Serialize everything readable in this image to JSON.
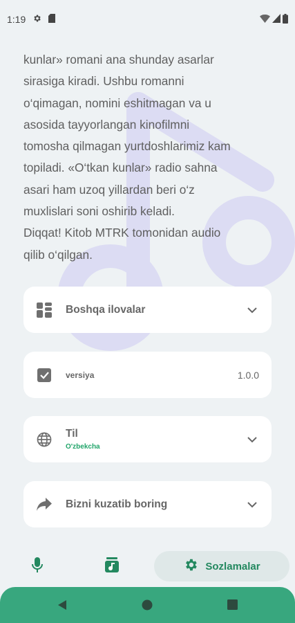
{
  "status_bar": {
    "time": "1:19",
    "icons": [
      "settings-icon",
      "sim-card-icon",
      "wifi-icon",
      "signal-icon",
      "battery-icon"
    ]
  },
  "description": {
    "lines": [
      "kunlar» romani ana shunday asarlar",
      "sirasiga kiradi. Ushbu romanni",
      "o‘qimagan, nomini eshitmagan va u",
      "asosida tayyorlangan kinofilmni",
      "tomosha qilmagan yurtdoshlarimiz kam",
      "topiladi. «O‘tkan kunlar» radio sahna",
      "asari ham uzoq yillardan beri o‘z",
      "muxlislari soni oshirib keladi.",
      "Diqqat! Kitob MTRK tomonidan audio",
      "qilib o‘qilgan."
    ]
  },
  "settings": {
    "other_apps": {
      "label": "Boshqa ilovalar",
      "icon": "apps-grid-icon"
    },
    "version": {
      "label": "versiya",
      "value": "1.0.0",
      "icon": "check-box-icon"
    },
    "language": {
      "label": "Til",
      "value": "O'zbekcha",
      "icon": "globe-icon"
    },
    "follow": {
      "label": "Bizni kuzatib boring",
      "icon": "share-arrow-icon"
    }
  },
  "bottom_nav": {
    "items": [
      {
        "icon": "microphone-icon",
        "label": ""
      },
      {
        "icon": "library-music-icon",
        "label": ""
      },
      {
        "icon": "gear-icon",
        "label": "Sozlamalar",
        "active": true
      }
    ]
  },
  "colors": {
    "accent": "#23885f",
    "accent_light": "#21a56a",
    "system_nav": "#38a77e",
    "background": "#eef2f4",
    "watermark": "#dcdcf3"
  }
}
